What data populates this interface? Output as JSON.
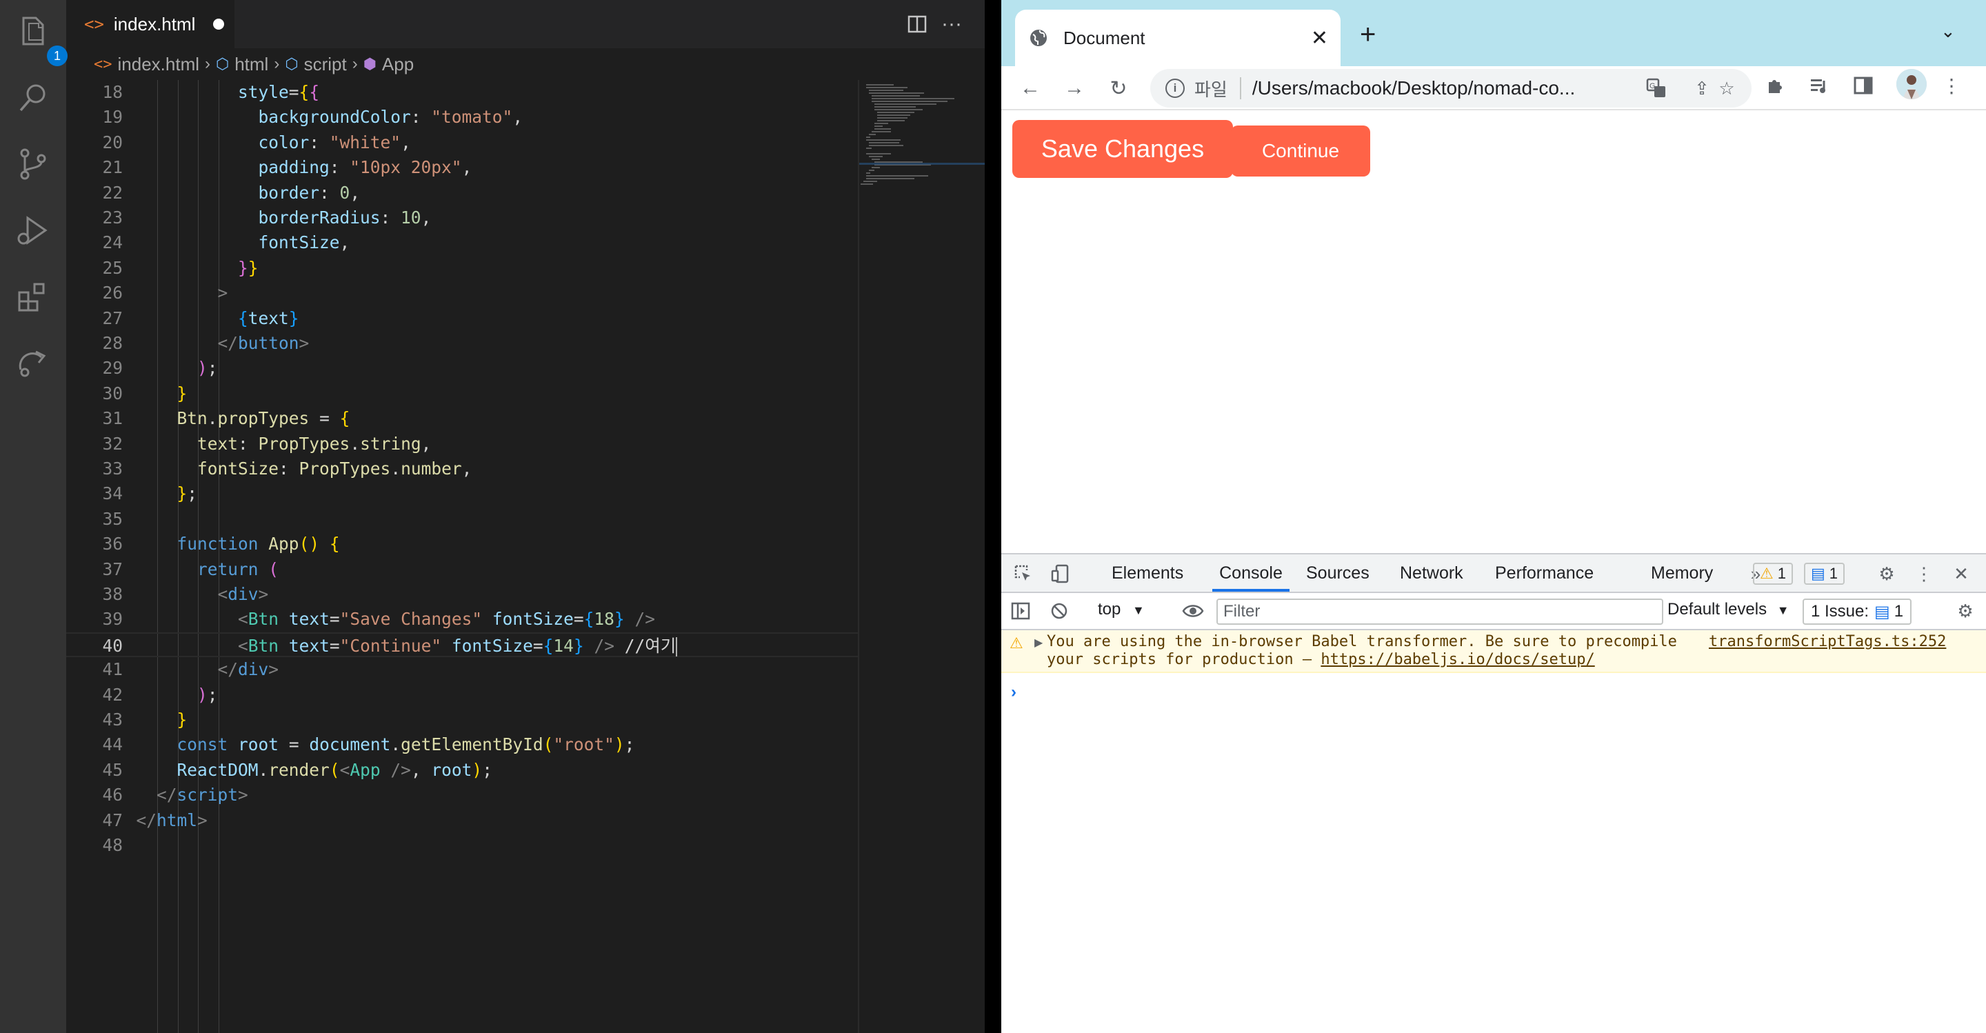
{
  "vscode": {
    "explorer_badge": "1",
    "tab": {
      "filename": "index.html"
    },
    "breadcrumb": [
      "index.html",
      "html",
      "script",
      "App"
    ],
    "code_lines": [
      {
        "n": "18",
        "tokens": [
          [
            "t-def",
            "            "
          ],
          [
            "t-prop",
            "style"
          ],
          [
            "t-def",
            "="
          ],
          [
            "t-brace",
            "{"
          ],
          [
            "t-brace2",
            "{"
          ]
        ]
      },
      {
        "n": "19",
        "tokens": [
          [
            "t-def",
            "              "
          ],
          [
            "t-prop",
            "backgroundColor"
          ],
          [
            "t-def",
            ": "
          ],
          [
            "t-str",
            "\"tomato\""
          ],
          [
            "t-def",
            ","
          ]
        ]
      },
      {
        "n": "20",
        "tokens": [
          [
            "t-def",
            "              "
          ],
          [
            "t-prop",
            "color"
          ],
          [
            "t-def",
            ": "
          ],
          [
            "t-str",
            "\"white\""
          ],
          [
            "t-def",
            ","
          ]
        ]
      },
      {
        "n": "21",
        "tokens": [
          [
            "t-def",
            "              "
          ],
          [
            "t-prop",
            "padding"
          ],
          [
            "t-def",
            ": "
          ],
          [
            "t-str",
            "\"10px 20px\""
          ],
          [
            "t-def",
            ","
          ]
        ]
      },
      {
        "n": "22",
        "tokens": [
          [
            "t-def",
            "              "
          ],
          [
            "t-prop",
            "border"
          ],
          [
            "t-def",
            ": "
          ],
          [
            "t-num",
            "0"
          ],
          [
            "t-def",
            ","
          ]
        ]
      },
      {
        "n": "23",
        "tokens": [
          [
            "t-def",
            "              "
          ],
          [
            "t-prop",
            "borderRadius"
          ],
          [
            "t-def",
            ": "
          ],
          [
            "t-num",
            "10"
          ],
          [
            "t-def",
            ","
          ]
        ]
      },
      {
        "n": "24",
        "tokens": [
          [
            "t-def",
            "              "
          ],
          [
            "t-prop",
            "fontSize"
          ],
          [
            "t-def",
            ","
          ]
        ]
      },
      {
        "n": "25",
        "tokens": [
          [
            "t-def",
            "            "
          ],
          [
            "t-brace2",
            "}"
          ],
          [
            "t-brace",
            "}"
          ]
        ]
      },
      {
        "n": "26",
        "tokens": [
          [
            "t-def",
            "          "
          ],
          [
            "t-punc",
            ">"
          ]
        ]
      },
      {
        "n": "27",
        "tokens": [
          [
            "t-def",
            "            "
          ],
          [
            "t-brace3",
            "{"
          ],
          [
            "t-prop",
            "text"
          ],
          [
            "t-brace3",
            "}"
          ]
        ]
      },
      {
        "n": "28",
        "tokens": [
          [
            "t-def",
            "          "
          ],
          [
            "t-punc",
            "</"
          ],
          [
            "t-html",
            "button"
          ],
          [
            "t-punc",
            ">"
          ]
        ]
      },
      {
        "n": "29",
        "tokens": [
          [
            "t-def",
            "        "
          ],
          [
            "t-brace2",
            ")"
          ],
          [
            "t-def",
            ";"
          ]
        ]
      },
      {
        "n": "30",
        "tokens": [
          [
            "t-def",
            "      "
          ],
          [
            "t-brace",
            "}"
          ]
        ]
      },
      {
        "n": "31",
        "tokens": [
          [
            "t-def",
            "      "
          ],
          [
            "t-fn",
            "Btn"
          ],
          [
            "t-def",
            "."
          ],
          [
            "t-fn",
            "propTypes"
          ],
          [
            "t-def",
            " = "
          ],
          [
            "t-brace",
            "{"
          ]
        ]
      },
      {
        "n": "32",
        "tokens": [
          [
            "t-def",
            "        "
          ],
          [
            "t-fn",
            "text"
          ],
          [
            "t-def",
            ": "
          ],
          [
            "t-fn",
            "PropTypes"
          ],
          [
            "t-def",
            "."
          ],
          [
            "t-fn",
            "string"
          ],
          [
            "t-def",
            ","
          ]
        ]
      },
      {
        "n": "33",
        "tokens": [
          [
            "t-def",
            "        "
          ],
          [
            "t-fn",
            "fontSize"
          ],
          [
            "t-def",
            ": "
          ],
          [
            "t-fn",
            "PropTypes"
          ],
          [
            "t-def",
            "."
          ],
          [
            "t-fn",
            "number"
          ],
          [
            "t-def",
            ","
          ]
        ]
      },
      {
        "n": "34",
        "tokens": [
          [
            "t-def",
            "      "
          ],
          [
            "t-brace",
            "}"
          ],
          [
            "t-def",
            ";"
          ]
        ]
      },
      {
        "n": "35",
        "tokens": []
      },
      {
        "n": "36",
        "tokens": [
          [
            "t-def",
            "      "
          ],
          [
            "t-kw",
            "function"
          ],
          [
            "t-def",
            " "
          ],
          [
            "t-fn",
            "App"
          ],
          [
            "t-brace",
            "("
          ],
          [
            "t-brace",
            ")"
          ],
          [
            "t-def",
            " "
          ],
          [
            "t-brace",
            "{"
          ]
        ]
      },
      {
        "n": "37",
        "tokens": [
          [
            "t-def",
            "        "
          ],
          [
            "t-kw",
            "return"
          ],
          [
            "t-def",
            " "
          ],
          [
            "t-brace2",
            "("
          ]
        ]
      },
      {
        "n": "38",
        "tokens": [
          [
            "t-def",
            "          "
          ],
          [
            "t-punc",
            "<"
          ],
          [
            "t-html",
            "div"
          ],
          [
            "t-punc",
            ">"
          ]
        ]
      },
      {
        "n": "39",
        "tokens": [
          [
            "t-def",
            "            "
          ],
          [
            "t-punc",
            "<"
          ],
          [
            "t-tag",
            "Btn"
          ],
          [
            "t-def",
            " "
          ],
          [
            "t-prop",
            "text"
          ],
          [
            "t-def",
            "="
          ],
          [
            "t-str",
            "\"Save Changes\""
          ],
          [
            "t-def",
            " "
          ],
          [
            "t-prop",
            "fontSize"
          ],
          [
            "t-def",
            "="
          ],
          [
            "t-brace3",
            "{"
          ],
          [
            "t-num",
            "18"
          ],
          [
            "t-brace3",
            "}"
          ],
          [
            "t-def",
            " "
          ],
          [
            "t-punc",
            "/>"
          ]
        ]
      },
      {
        "n": "40",
        "current": true,
        "tokens": [
          [
            "t-def",
            "            "
          ],
          [
            "t-punc",
            "<"
          ],
          [
            "t-tag",
            "Btn"
          ],
          [
            "t-def",
            " "
          ],
          [
            "t-prop",
            "text"
          ],
          [
            "t-def",
            "="
          ],
          [
            "t-str",
            "\"Continue\""
          ],
          [
            "t-def",
            " "
          ],
          [
            "t-prop",
            "fontSize"
          ],
          [
            "t-def",
            "="
          ],
          [
            "t-brace3",
            "{"
          ],
          [
            "t-num",
            "14"
          ],
          [
            "t-brace3",
            "}"
          ],
          [
            "t-def",
            " "
          ],
          [
            "t-punc",
            "/>"
          ],
          [
            "t-def",
            " //여기"
          ]
        ]
      },
      {
        "n": "41",
        "tokens": [
          [
            "t-def",
            "          "
          ],
          [
            "t-punc",
            "</"
          ],
          [
            "t-html",
            "div"
          ],
          [
            "t-punc",
            ">"
          ]
        ]
      },
      {
        "n": "42",
        "tokens": [
          [
            "t-def",
            "        "
          ],
          [
            "t-brace2",
            ")"
          ],
          [
            "t-def",
            ";"
          ]
        ]
      },
      {
        "n": "43",
        "tokens": [
          [
            "t-def",
            "      "
          ],
          [
            "t-brace",
            "}"
          ]
        ]
      },
      {
        "n": "44",
        "tokens": [
          [
            "t-def",
            "      "
          ],
          [
            "t-kw",
            "const"
          ],
          [
            "t-def",
            " "
          ],
          [
            "t-prop",
            "root"
          ],
          [
            "t-def",
            " = "
          ],
          [
            "t-prop",
            "document"
          ],
          [
            "t-def",
            "."
          ],
          [
            "t-fn",
            "getElementById"
          ],
          [
            "t-brace",
            "("
          ],
          [
            "t-str",
            "\"root\""
          ],
          [
            "t-brace",
            ")"
          ],
          [
            "t-def",
            ";"
          ]
        ]
      },
      {
        "n": "45",
        "tokens": [
          [
            "t-def",
            "      "
          ],
          [
            "t-prop",
            "ReactDOM"
          ],
          [
            "t-def",
            "."
          ],
          [
            "t-fn",
            "render"
          ],
          [
            "t-brace",
            "("
          ],
          [
            "t-punc",
            "<"
          ],
          [
            "t-tag",
            "App"
          ],
          [
            "t-def",
            " "
          ],
          [
            "t-punc",
            "/>"
          ],
          [
            "t-def",
            ", "
          ],
          [
            "t-prop",
            "root"
          ],
          [
            "t-brace",
            ")"
          ],
          [
            "t-def",
            ";"
          ]
        ]
      },
      {
        "n": "46",
        "tokens": [
          [
            "t-def",
            "    "
          ],
          [
            "t-punc",
            "</"
          ],
          [
            "t-html",
            "script"
          ],
          [
            "t-punc",
            ">"
          ]
        ]
      },
      {
        "n": "47",
        "tokens": [
          [
            "t-def",
            "  "
          ],
          [
            "t-punc",
            "</"
          ],
          [
            "t-html",
            "html"
          ],
          [
            "t-punc",
            ">"
          ]
        ]
      },
      {
        "n": "48",
        "tokens": []
      }
    ]
  },
  "chrome": {
    "tab_title": "Document",
    "address": {
      "scheme_label": "파일",
      "url": "/Users/macbook/Desktop/nomad-co..."
    },
    "page": {
      "save_button": "Save Changes",
      "continue_button": "Continue",
      "button_color": "#ff6347"
    },
    "devtools": {
      "tabs": [
        "Elements",
        "Console",
        "Sources",
        "Network",
        "Performance",
        "Memory"
      ],
      "active_tab": "Console",
      "warning_count": "1",
      "info_count": "1",
      "context": "top",
      "filter_placeholder": "Filter",
      "levels": "Default levels",
      "issues_label": "1 Issue:",
      "issues_count": "1",
      "warning": {
        "line1": "You are using the in-browser Babel transformer. Be sure to precompile",
        "line2_prefix": "your scripts for production – ",
        "link": "https://babeljs.io/docs/setup/",
        "source": "transformScriptTags.ts:252"
      },
      "prompt": "›"
    }
  }
}
